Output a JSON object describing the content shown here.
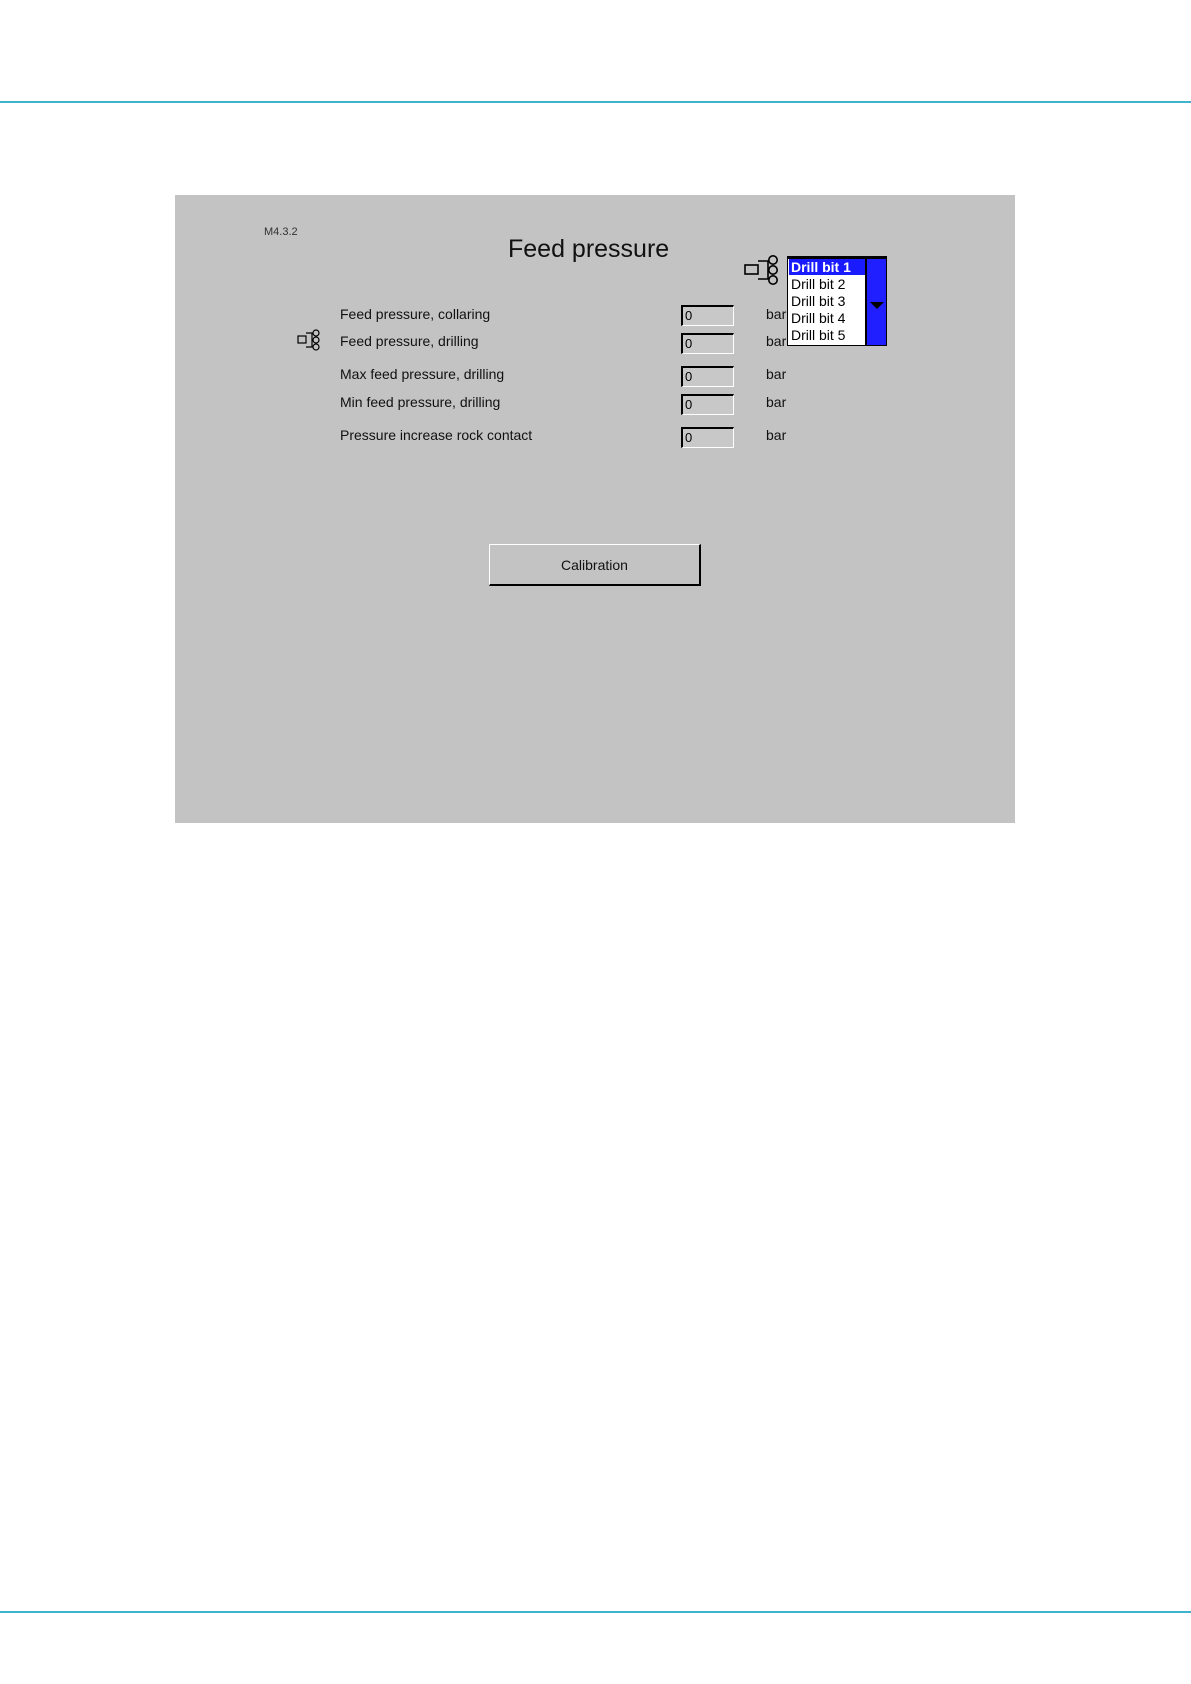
{
  "screen": {
    "id": "M4.3.2",
    "title": "Feed pressure"
  },
  "rows": [
    {
      "label": "Feed pressure, collaring",
      "value": "0",
      "unit": "bar"
    },
    {
      "label": "Feed pressure, drilling",
      "value": "0",
      "unit": "bar"
    },
    {
      "label": "Max feed pressure, drilling",
      "value": "0",
      "unit": "bar"
    },
    {
      "label": "Min feed pressure, drilling",
      "value": "0",
      "unit": "bar"
    },
    {
      "label": "Pressure increase rock contact",
      "value": "0",
      "unit": "bar"
    }
  ],
  "drill_bit_list": {
    "items": [
      "Drill bit 1",
      "Drill bit 2",
      "Drill bit 3",
      "Drill bit 4",
      "Drill bit 5"
    ],
    "selected": "Drill bit 1"
  },
  "buttons": {
    "calibration": "Calibration"
  },
  "icons": {
    "drill_bit_selector": "drill-bit-icon",
    "row_drill_bit": "drill-bit-icon",
    "scroll_down": "triangle-down-icon"
  },
  "colors": {
    "panel": "#c3c3c3",
    "selection": "#1a1aff",
    "accent_rule": "#3fb2cc"
  }
}
